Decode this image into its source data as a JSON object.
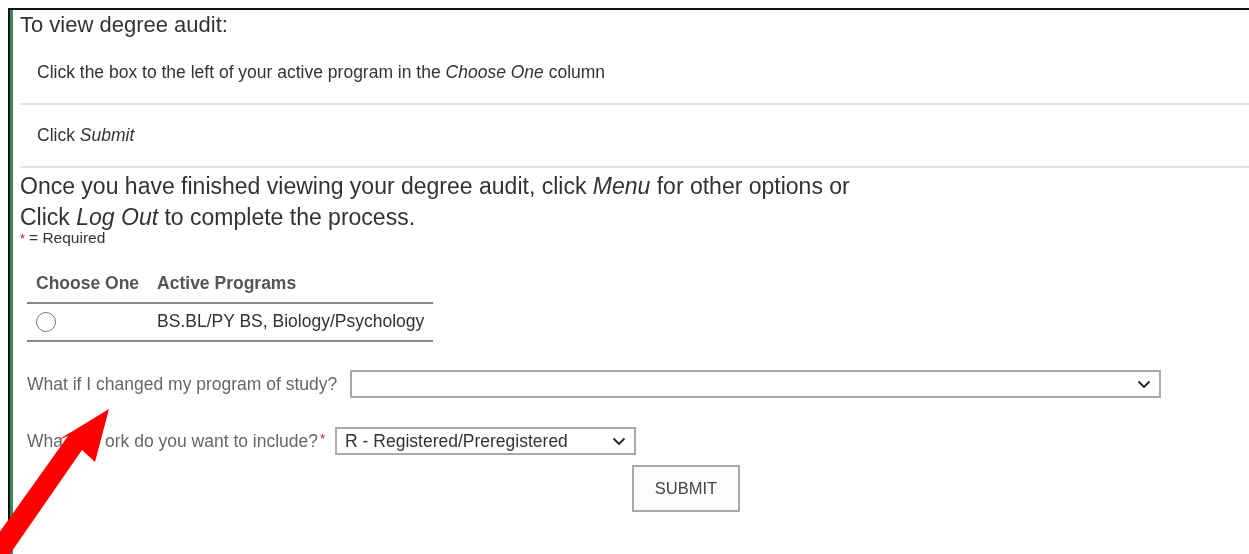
{
  "heading": "To view degree audit:",
  "steps": [
    "Click the box to the left of your active program in the *Choose One* column",
    "Click *Submit*"
  ],
  "closing_lines": [
    "Once you have finished viewing your degree audit, click *Menu* for other options or",
    "Click *Log Out* to complete the process."
  ],
  "required_note": {
    "marker": "*",
    "text": "= Required"
  },
  "table": {
    "columns": [
      "Choose One",
      "Active Programs"
    ],
    "rows": [
      {
        "selected": false,
        "program": "BS.BL/PY BS, Biology/Psychology"
      }
    ]
  },
  "what_if": {
    "label": "What if I changed my program of study?"
  },
  "work": {
    "label_parts": [
      "Wha",
      "ork do you want to include?"
    ],
    "required_mark": "*",
    "value": "R - Registered/Preregistered"
  },
  "submit": "SUBMIT",
  "annotation": {
    "kind": "arrow"
  }
}
